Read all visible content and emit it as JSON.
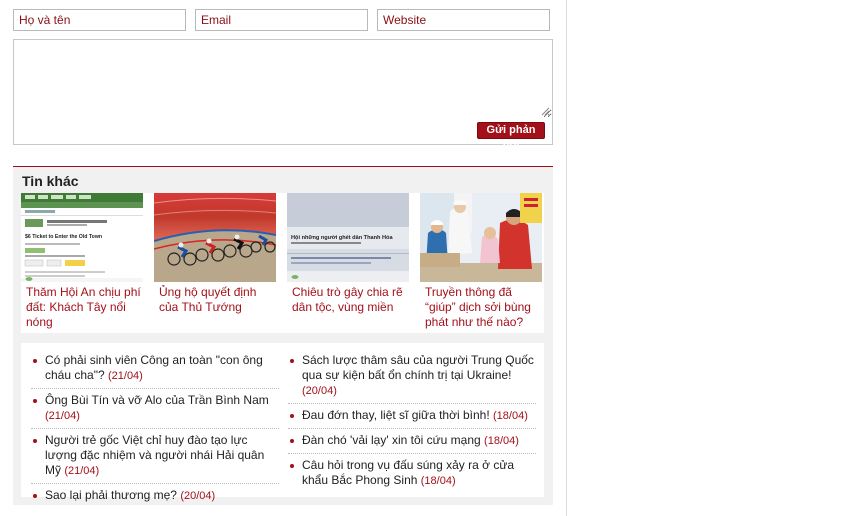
{
  "comment_form": {
    "name_placeholder": "Họ và tên",
    "email_placeholder": "Email",
    "website_placeholder": "Website",
    "message_value": "",
    "submit_label": "Gửi phản hồi"
  },
  "other_news": {
    "title": "Tin khác",
    "featured": [
      {
        "caption": "Thăm Hội An chịu phí đất: Khách Tây nổi nóng",
        "thumb_text": "$6 Ticket to Enter the Old Town"
      },
      {
        "caption": "Ủng hộ quyết định của Thủ Tướng"
      },
      {
        "caption": "Chiêu trò gây chia rẽ dân tộc, vùng miền",
        "thumb_text": "Hội những người ghét dân Thanh Hóa"
      },
      {
        "caption": "Truyền thông đã “giúp” dịch sởi bùng phát như thế nào?"
      }
    ],
    "list_left": [
      {
        "title": "Có phải sinh viên Công an toàn \"con ông cháu cha\"?",
        "date": "(21/04)"
      },
      {
        "title": "Ông Bùi Tín và vỡ Alo của Trần Bình Nam",
        "date": "(21/04)"
      },
      {
        "title": "Người trẻ gốc Việt chỉ huy đào tạo lực lượng đặc nhiệm và người nhái Hải quân Mỹ",
        "date": "(21/04)"
      },
      {
        "title": "Sao lại phải thương mẹ?",
        "date": "(20/04)"
      }
    ],
    "list_right": [
      {
        "title": "Sách lược thâm sâu của người Trung Quốc qua sự kiện bất ổn chính trị tại Ukraine!",
        "date": "(20/04)"
      },
      {
        "title": "Đau đớn thay, liệt sĩ giữa thời bình!",
        "date": "(18/04)"
      },
      {
        "title": "Đàn chó 'vải lạy' xin tôi cứu mạng",
        "date": "(18/04)"
      },
      {
        "title": "Câu hỏi trong vụ đấu súng xảy ra ở cửa khẩu Bắc Phong Sinh",
        "date": "(18/04)"
      }
    ]
  },
  "colors": {
    "accent": "#a3101a",
    "panel_bg": "#f1f1f1"
  }
}
